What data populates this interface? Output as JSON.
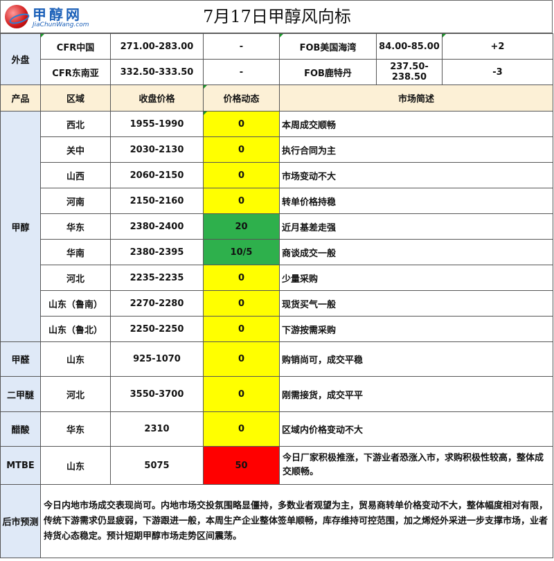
{
  "header": {
    "brand": "甲醇网",
    "url": "JiaChunWang.com",
    "title": "7月17日甲醇风向标"
  },
  "external": {
    "label": "外盘",
    "rows": [
      {
        "name": "CFR中国",
        "price": "271.00-283.00",
        "change": "-",
        "name2": "FOB美国海湾",
        "price2": "84.00-85.00",
        "change2": "+2"
      },
      {
        "name": "CFR东南亚",
        "price": "332.50-333.50",
        "change": "-",
        "name2": "FOB鹿特丹",
        "price2": "237.50-238.50",
        "change2": "-3"
      }
    ]
  },
  "columns": {
    "product": "产品",
    "region": "区域",
    "close_price": "收盘价格",
    "price_move": "价格动态",
    "summary": "市场简述"
  },
  "methanol": {
    "label": "甲醇",
    "rows": [
      {
        "region": "西北",
        "price": "1955-1990",
        "move": "0",
        "note": "本周成交顺畅",
        "color": "#ffff00"
      },
      {
        "region": "关中",
        "price": "2030-2130",
        "move": "0",
        "note": "执行合同为主",
        "color": "#ffff00"
      },
      {
        "region": "山西",
        "price": "2060-2150",
        "move": "0",
        "note": "市场变动不大",
        "color": "#ffff00"
      },
      {
        "region": "河南",
        "price": "2150-2160",
        "move": "0",
        "note": "转单价格持稳",
        "color": "#ffff00"
      },
      {
        "region": "华东",
        "price": "2380-2400",
        "move": "20",
        "note": "近月基差走强",
        "color": "#2eb04c"
      },
      {
        "region": "华南",
        "price": "2380-2395",
        "move": "10/5",
        "note": "商谈成交一般",
        "color": "#2eb04c"
      },
      {
        "region": "河北",
        "price": "2235-2235",
        "move": "0",
        "note": "少量采购",
        "color": "#ffff00"
      },
      {
        "region": "山东（鲁南）",
        "price": "2270-2280",
        "move": "0",
        "note": "现货买气一般",
        "color": "#ffff00"
      },
      {
        "region": "山东（鲁北）",
        "price": "2250-2250",
        "move": "0",
        "note": "下游按需采购",
        "color": "#ffff00"
      }
    ]
  },
  "others": [
    {
      "product": "甲醛",
      "region": "山东",
      "price": "925-1070",
      "move": "0",
      "note": "购销尚可，成交平稳",
      "color": "#ffff00"
    },
    {
      "product": "二甲醚",
      "region": "河北",
      "price": "3550-3700",
      "move": "0",
      "note": "刚需接货，成交平平",
      "color": "#ffff00"
    },
    {
      "product": "醋酸",
      "region": "华东",
      "price": "2310",
      "move": "0",
      "note": "区域内价格变动不大",
      "color": "#ffff00"
    },
    {
      "product": "MTBE",
      "region": "山东",
      "price": "5075",
      "move": "50",
      "note": "今日厂家积极推涨，下游业者恐涨入市，求购积极性较高，整体成交顺畅。",
      "color": "#ff0000"
    }
  ],
  "forecast": {
    "label": "后市预测",
    "text": "今日内地市场成交表现尚可。内地市场交投氛围略显僵持，多数业者观望为主，贸易商转单价格变动不大，整体幅度相对有限，传统下游需求仍显疲弱，下游跟进一般，本周生产企业整体签单顺畅，库存维持可控范围，加之烯烃外采进一步支撑市场，业者持货心态稳定。预计短期甲醇市场走势区间震荡。"
  }
}
